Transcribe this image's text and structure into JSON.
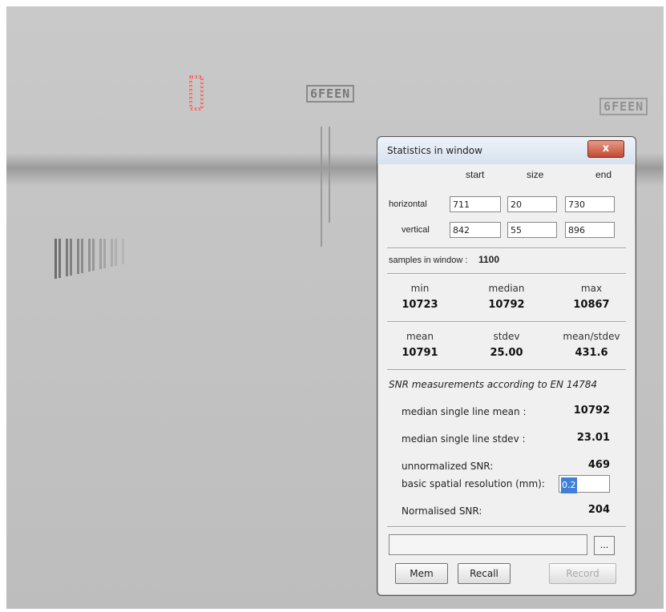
{
  "image": {
    "iqi_label_1": "6FEEN",
    "iqi_label_2": "6FEEN"
  },
  "dialog": {
    "title": "Statistics in window",
    "close_label": "x",
    "col_start": "start",
    "col_size": "size",
    "col_end": "end",
    "row_horizontal": "horizontal",
    "row_vertical": "vertical",
    "h_start": "711",
    "h_size": "20",
    "h_end": "730",
    "v_start": "842",
    "v_size": "55",
    "v_end": "896",
    "samples_label": "samples in window :",
    "samples_value": "1100",
    "min_label": "min",
    "median_label": "median",
    "max_label": "max",
    "min_value": "10723",
    "median_value": "10792",
    "max_value": "10867",
    "mean_label": "mean",
    "stdev_label": "stdev",
    "ratio_label": "mean/stdev",
    "mean_value": "10791",
    "stdev_value": "25.00",
    "ratio_value": "431.6",
    "snr_title": "SNR measurements according to EN 14784",
    "snr": {
      "median_mean_label": "median single line mean :",
      "median_mean_value": "10792",
      "median_stdev_label": "median single line stdev :",
      "median_stdev_value": "23.01",
      "unnorm_label": "unnormalized SNR:",
      "unnorm_value": "469",
      "resolution_label": "basic spatial resolution (mm):",
      "resolution_value": "0.2",
      "normalised_label": "Normalised SNR:",
      "normalised_value": "204"
    },
    "browse_label": "...",
    "mem_label": "Mem",
    "recall_label": "Recall",
    "record_label": "Record"
  }
}
